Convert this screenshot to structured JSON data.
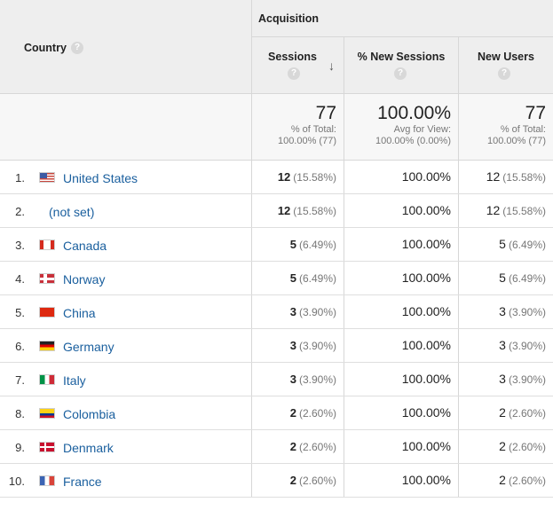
{
  "header": {
    "country_label": "Country",
    "help_glyph": "?",
    "group_label": "Acquisition",
    "columns": [
      {
        "label": "Sessions",
        "sorted": "descending"
      },
      {
        "label": "% New Sessions"
      },
      {
        "label": "New Users"
      }
    ],
    "sort_arrow": "↓"
  },
  "totals": {
    "sessions": {
      "value": "77",
      "line1": "% of Total:",
      "line2": "100.00% (77)"
    },
    "new_sessions": {
      "value": "100.00%",
      "line1": "Avg for View:",
      "line2": "100.00% (0.00%)"
    },
    "new_users": {
      "value": "77",
      "line1": "% of Total:",
      "line2": "100.00% (77)"
    }
  },
  "rows": [
    {
      "idx": "1.",
      "flag": "us-flag-icon",
      "country": "United States",
      "sessions": "12",
      "sessions_pct": "(15.58%)",
      "new_sessions": "100.00%",
      "new_users": "12",
      "new_users_pct": "(15.58%)"
    },
    {
      "idx": "2.",
      "flag": "",
      "country": "(not set)",
      "sessions": "12",
      "sessions_pct": "(15.58%)",
      "new_sessions": "100.00%",
      "new_users": "12",
      "new_users_pct": "(15.58%)"
    },
    {
      "idx": "3.",
      "flag": "canada-flag-icon",
      "country": "Canada",
      "sessions": "5",
      "sessions_pct": "(6.49%)",
      "new_sessions": "100.00%",
      "new_users": "5",
      "new_users_pct": "(6.49%)"
    },
    {
      "idx": "4.",
      "flag": "norway-flag-icon",
      "country": "Norway",
      "sessions": "5",
      "sessions_pct": "(6.49%)",
      "new_sessions": "100.00%",
      "new_users": "5",
      "new_users_pct": "(6.49%)"
    },
    {
      "idx": "5.",
      "flag": "china-flag-icon",
      "country": "China",
      "sessions": "3",
      "sessions_pct": "(3.90%)",
      "new_sessions": "100.00%",
      "new_users": "3",
      "new_users_pct": "(3.90%)"
    },
    {
      "idx": "6.",
      "flag": "germany-flag-icon",
      "country": "Germany",
      "sessions": "3",
      "sessions_pct": "(3.90%)",
      "new_sessions": "100.00%",
      "new_users": "3",
      "new_users_pct": "(3.90%)"
    },
    {
      "idx": "7.",
      "flag": "italy-flag-icon",
      "country": "Italy",
      "sessions": "3",
      "sessions_pct": "(3.90%)",
      "new_sessions": "100.00%",
      "new_users": "3",
      "new_users_pct": "(3.90%)"
    },
    {
      "idx": "8.",
      "flag": "colombia-flag-icon",
      "country": "Colombia",
      "sessions": "2",
      "sessions_pct": "(2.60%)",
      "new_sessions": "100.00%",
      "new_users": "2",
      "new_users_pct": "(2.60%)"
    },
    {
      "idx": "9.",
      "flag": "denmark-flag-icon",
      "country": "Denmark",
      "sessions": "2",
      "sessions_pct": "(2.60%)",
      "new_sessions": "100.00%",
      "new_users": "2",
      "new_users_pct": "(2.60%)"
    },
    {
      "idx": "10.",
      "flag": "france-flag-icon",
      "country": "France",
      "sessions": "2",
      "sessions_pct": "(2.60%)",
      "new_sessions": "100.00%",
      "new_users": "2",
      "new_users_pct": "(2.60%)"
    }
  ]
}
